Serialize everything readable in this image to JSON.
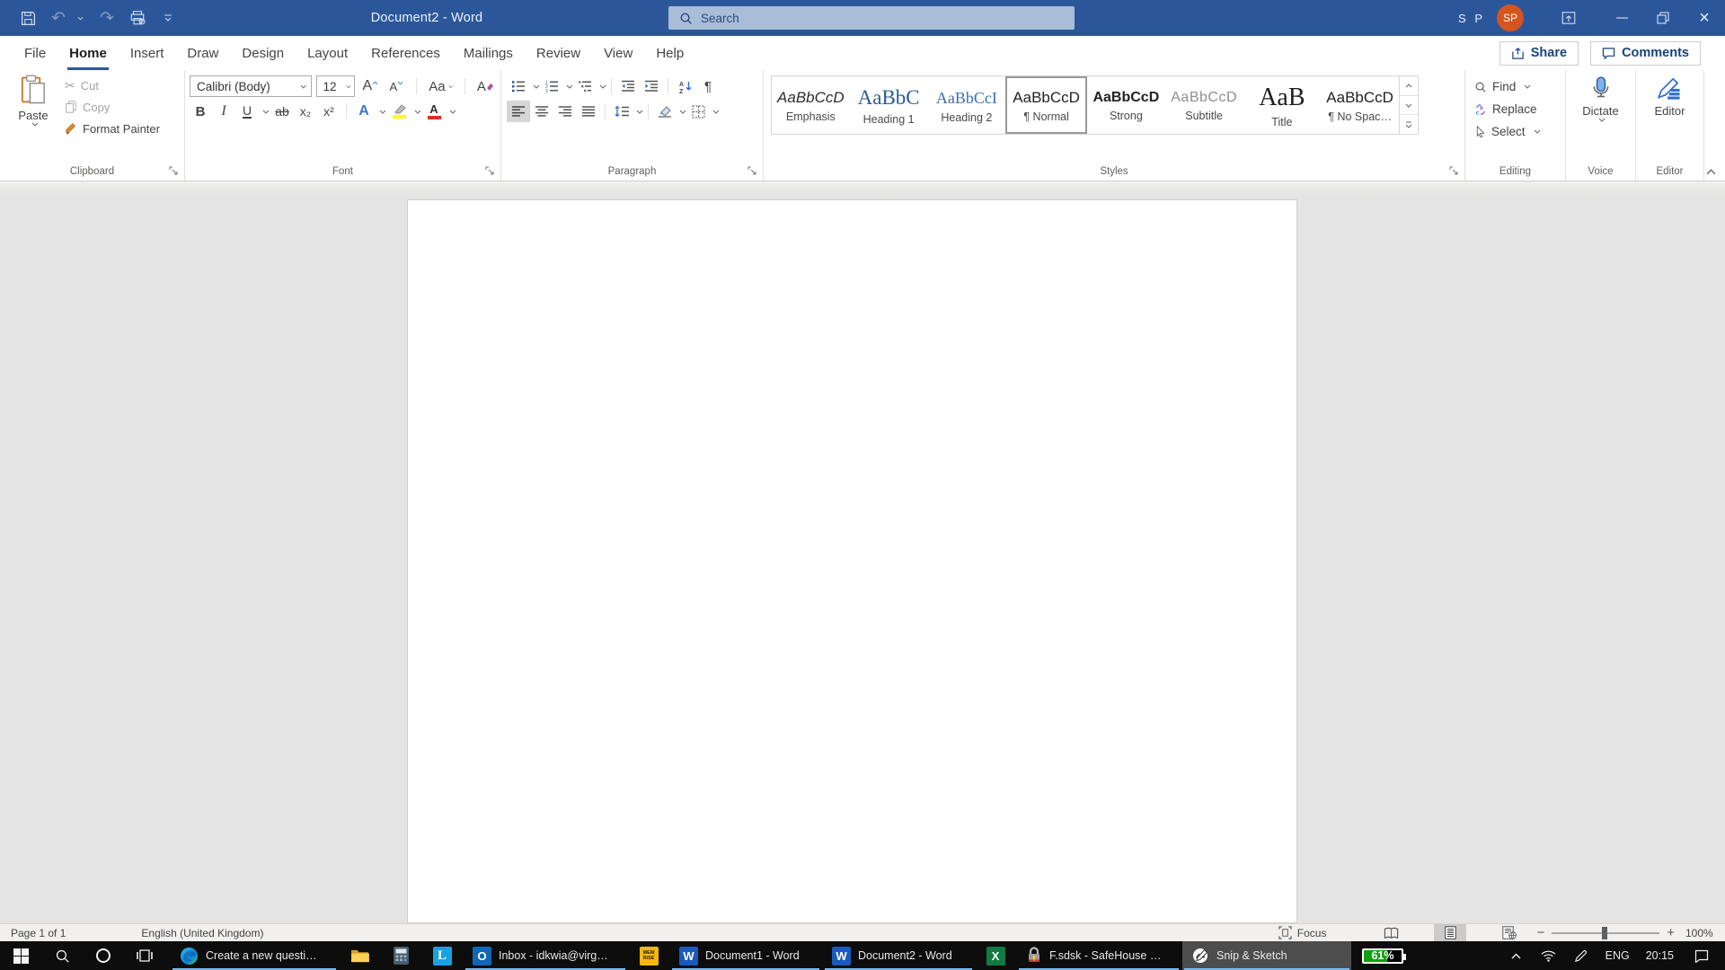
{
  "titlebar": {
    "title": "Document2 - Word",
    "search_placeholder": "Search",
    "user_text": "S P",
    "avatar_initials": "SP"
  },
  "tabs": {
    "items": [
      "File",
      "Home",
      "Insert",
      "Draw",
      "Design",
      "Layout",
      "References",
      "Mailings",
      "Review",
      "View",
      "Help"
    ]
  },
  "header_actions": {
    "share": "Share",
    "comments": "Comments"
  },
  "ribbon": {
    "clipboard": {
      "label": "Clipboard",
      "paste": "Paste",
      "cut": "Cut",
      "copy": "Copy",
      "format_painter": "Format Painter"
    },
    "font": {
      "label": "Font",
      "name": "Calibri (Body)",
      "size": "12",
      "bold": "B",
      "italic": "I",
      "underline": "U",
      "strikethrough": "ab",
      "subscript": "x₂",
      "superscript": "x²",
      "change_case": "Aa",
      "clear_formatting": "A",
      "grow_font": "A",
      "shrink_font": "A",
      "text_effects": "A",
      "font_color": "A"
    },
    "paragraph": {
      "label": "Paragraph",
      "pilcrow": "¶",
      "sort_a": "A",
      "sort_z": "Z"
    },
    "styles": {
      "label": "Styles",
      "items": [
        {
          "preview": "AaBbCcD",
          "name": "Emphasis"
        },
        {
          "preview": "AaBbC",
          "name": "Heading 1"
        },
        {
          "preview": "AaBbCcI",
          "name": "Heading 2"
        },
        {
          "preview": "AaBbCcD",
          "name": "¶ Normal"
        },
        {
          "preview": "AaBbCcD",
          "name": "Strong"
        },
        {
          "preview": "AaBbCcD",
          "name": "Subtitle"
        },
        {
          "preview": "AaB",
          "name": "Title"
        },
        {
          "preview": "AaBbCcD",
          "name": "¶ No Spac…"
        }
      ]
    },
    "editing": {
      "label": "Editing",
      "find": "Find",
      "replace": "Replace",
      "select": "Select"
    },
    "voice": {
      "label": "Voice",
      "dictate": "Dictate"
    },
    "editor_group": {
      "label": "Editor",
      "editor": "Editor"
    }
  },
  "statusbar": {
    "page": "Page 1 of 1",
    "language": "English (United Kingdom)",
    "focus": "Focus",
    "zoom_level": "100%"
  },
  "taskbar": {
    "edge_label": "Create a new questi…",
    "outlook_label": "Inbox - idkwia@virg…",
    "word1_label": "Document1 - Word",
    "word2_label": "Document2 - Word",
    "safehouse_label": "F.sdsk - SafeHouse …",
    "snip_label": "Snip & Sketch",
    "memrise_line1": "MEM",
    "memrise_line2": "RiSE",
    "app_letters": {
      "outlook": "O",
      "word": "W",
      "excel": "X",
      "l_app": "L"
    },
    "battery": "61%",
    "tray": {
      "language": "ENG",
      "time": "20:15"
    }
  },
  "colors": {
    "accent": "#2b579a",
    "avatar": "#d4551e",
    "open_underline": "#76b9ed",
    "battery_green": "#11a00f"
  }
}
